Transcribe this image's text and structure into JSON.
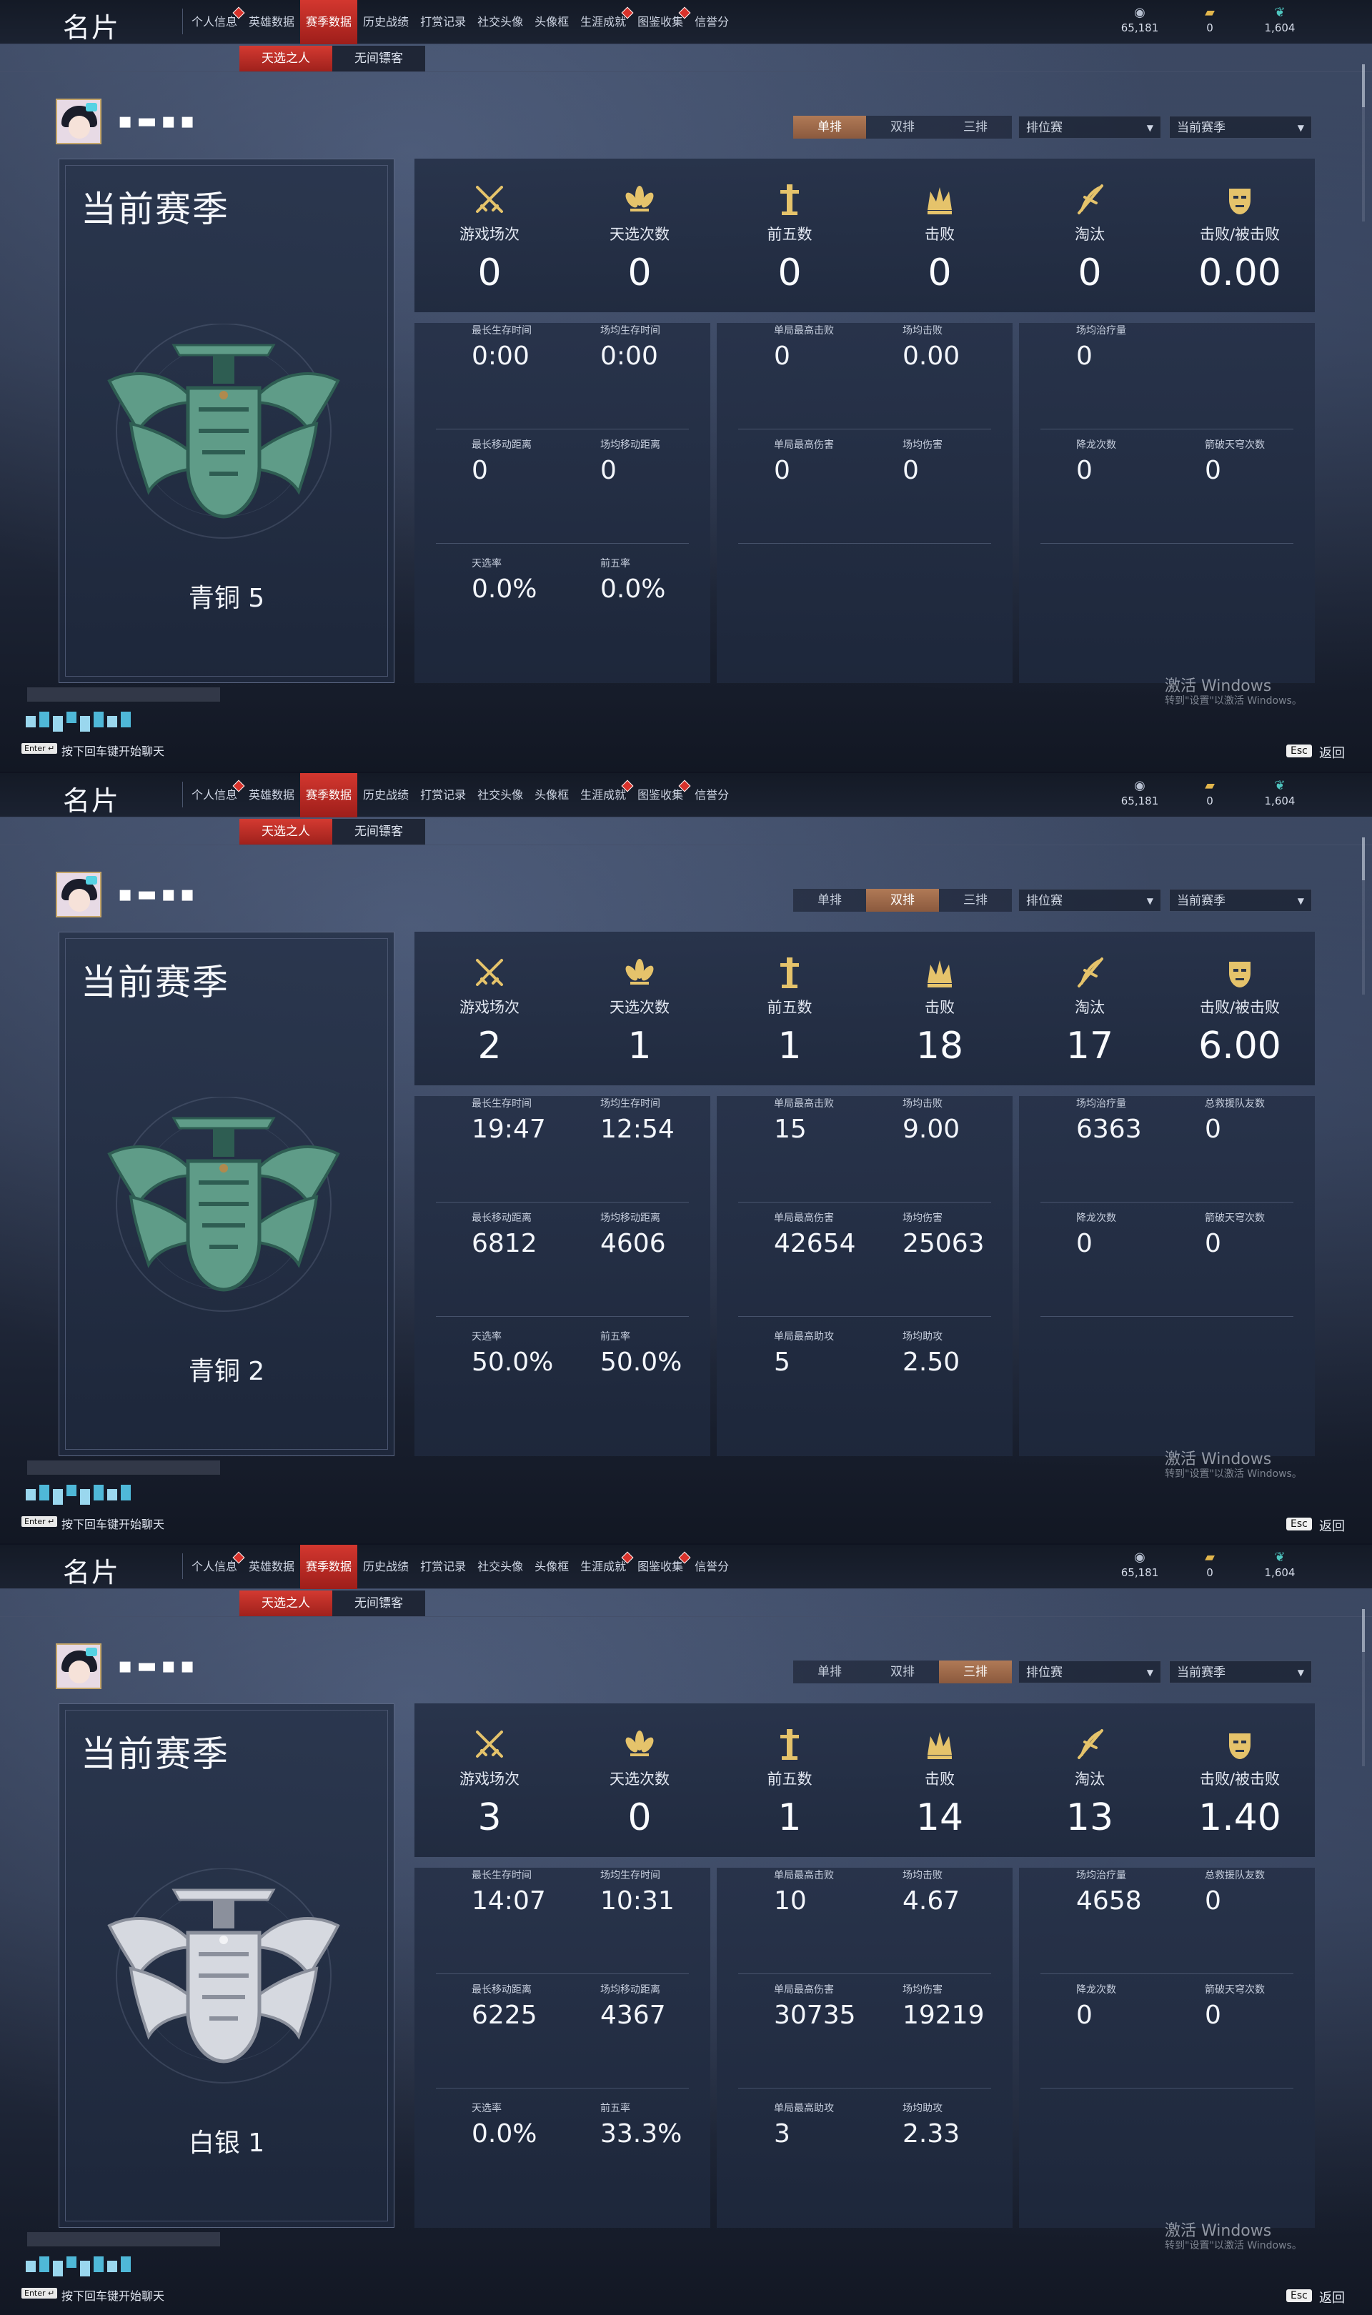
{
  "nav": {
    "brand": "名片",
    "items": [
      {
        "label": "个人信息",
        "badge": true
      },
      {
        "label": "英雄数据",
        "badge": false
      },
      {
        "label": "赛季数据",
        "badge": false
      },
      {
        "label": "历史战绩",
        "badge": false
      },
      {
        "label": "打赏记录",
        "badge": false
      },
      {
        "label": "社交头像",
        "badge": false
      },
      {
        "label": "头像框",
        "badge": false
      },
      {
        "label": "生涯成就",
        "badge": true
      },
      {
        "label": "图鉴收集",
        "badge": true
      },
      {
        "label": "信誉分",
        "badge": false
      }
    ],
    "active_index": 2
  },
  "currency": [
    {
      "icon": "coin-icon",
      "value": "65,181"
    },
    {
      "icon": "ticket-icon",
      "value": "0"
    },
    {
      "icon": "feather-icon",
      "value": "1,604"
    }
  ],
  "subtabs": [
    "天选之人",
    "无间镖客"
  ],
  "player": {
    "name": "▪▬▪▪"
  },
  "mode_tabs": [
    "单排",
    "双排",
    "三排"
  ],
  "dropdown_mode": "排位赛",
  "dropdown_season": "当前赛季",
  "rank_title": "当前赛季",
  "summary_labels": [
    "游戏场次",
    "天选次数",
    "前五数",
    "击败",
    "淘汰",
    "击败/被击败"
  ],
  "detail_labels": {
    "box1": [
      [
        "最长生存时间",
        "场均生存时间"
      ],
      [
        "最长移动距离",
        "场均移动距离"
      ],
      [
        "天选率",
        "前五率"
      ]
    ],
    "box2": [
      [
        "单局最高击败",
        "场均击败"
      ],
      [
        "单局最高伤害",
        "场均伤害"
      ],
      [
        "单局最高助攻",
        "场均助攻"
      ]
    ],
    "box3": [
      [
        "场均治疗量",
        "总救援队友数"
      ],
      [
        "降龙次数",
        "箭破天穹次数"
      ],
      [
        "",
        ""
      ]
    ]
  },
  "footer": {
    "enter_key": "Enter ↵",
    "enter_hint": "按下回车键开始聊天",
    "activate_title": "激活 Windows",
    "activate_sub": "转到\"设置\"以激活 Windows。",
    "esc_key": "Esc",
    "esc_label": "返回"
  },
  "colors": {
    "accent_red": "#c92d27",
    "mode_active": "#9c6a4a",
    "bronze": "#4f8f7d",
    "silver": "#c9ccd4",
    "gold_icon": "#e5c36b"
  },
  "panels": [
    {
      "active_mode": 0,
      "rank_name": "青铜 5",
      "emblem": "bronze",
      "summary": [
        "0",
        "0",
        "0",
        "0",
        "0",
        "0.00"
      ],
      "box1": [
        [
          "0:00",
          "0:00"
        ],
        [
          "0",
          "0"
        ],
        [
          "0.0%",
          "0.0%"
        ]
      ],
      "box2": [
        [
          "0",
          "0.00"
        ],
        [
          "0",
          "0"
        ],
        [
          "",
          ""
        ]
      ],
      "box3": [
        [
          "0",
          ""
        ],
        [
          "0",
          "0"
        ],
        [
          "",
          ""
        ]
      ],
      "show_heal_label2": false,
      "show_box2_row3": false
    },
    {
      "active_mode": 1,
      "rank_name": "青铜 2",
      "emblem": "bronze",
      "summary": [
        "2",
        "1",
        "1",
        "18",
        "17",
        "6.00"
      ],
      "box1": [
        [
          "19:47",
          "12:54"
        ],
        [
          "6812",
          "4606"
        ],
        [
          "50.0%",
          "50.0%"
        ]
      ],
      "box2": [
        [
          "15",
          "9.00"
        ],
        [
          "42654",
          "25063"
        ],
        [
          "5",
          "2.50"
        ]
      ],
      "box3": [
        [
          "6363",
          "0"
        ],
        [
          "0",
          "0"
        ],
        [
          "",
          ""
        ]
      ],
      "show_heal_label2": true,
      "show_box2_row3": true
    },
    {
      "active_mode": 2,
      "rank_name": "白银 1",
      "emblem": "silver",
      "summary": [
        "3",
        "0",
        "1",
        "14",
        "13",
        "1.40"
      ],
      "box1": [
        [
          "14:07",
          "10:31"
        ],
        [
          "6225",
          "4367"
        ],
        [
          "0.0%",
          "33.3%"
        ]
      ],
      "box2": [
        [
          "10",
          "4.67"
        ],
        [
          "30735",
          "19219"
        ],
        [
          "3",
          "2.33"
        ]
      ],
      "box3": [
        [
          "4658",
          "0"
        ],
        [
          "0",
          "0"
        ],
        [
          "",
          ""
        ]
      ],
      "show_heal_label2": true,
      "show_box2_row3": true
    }
  ]
}
